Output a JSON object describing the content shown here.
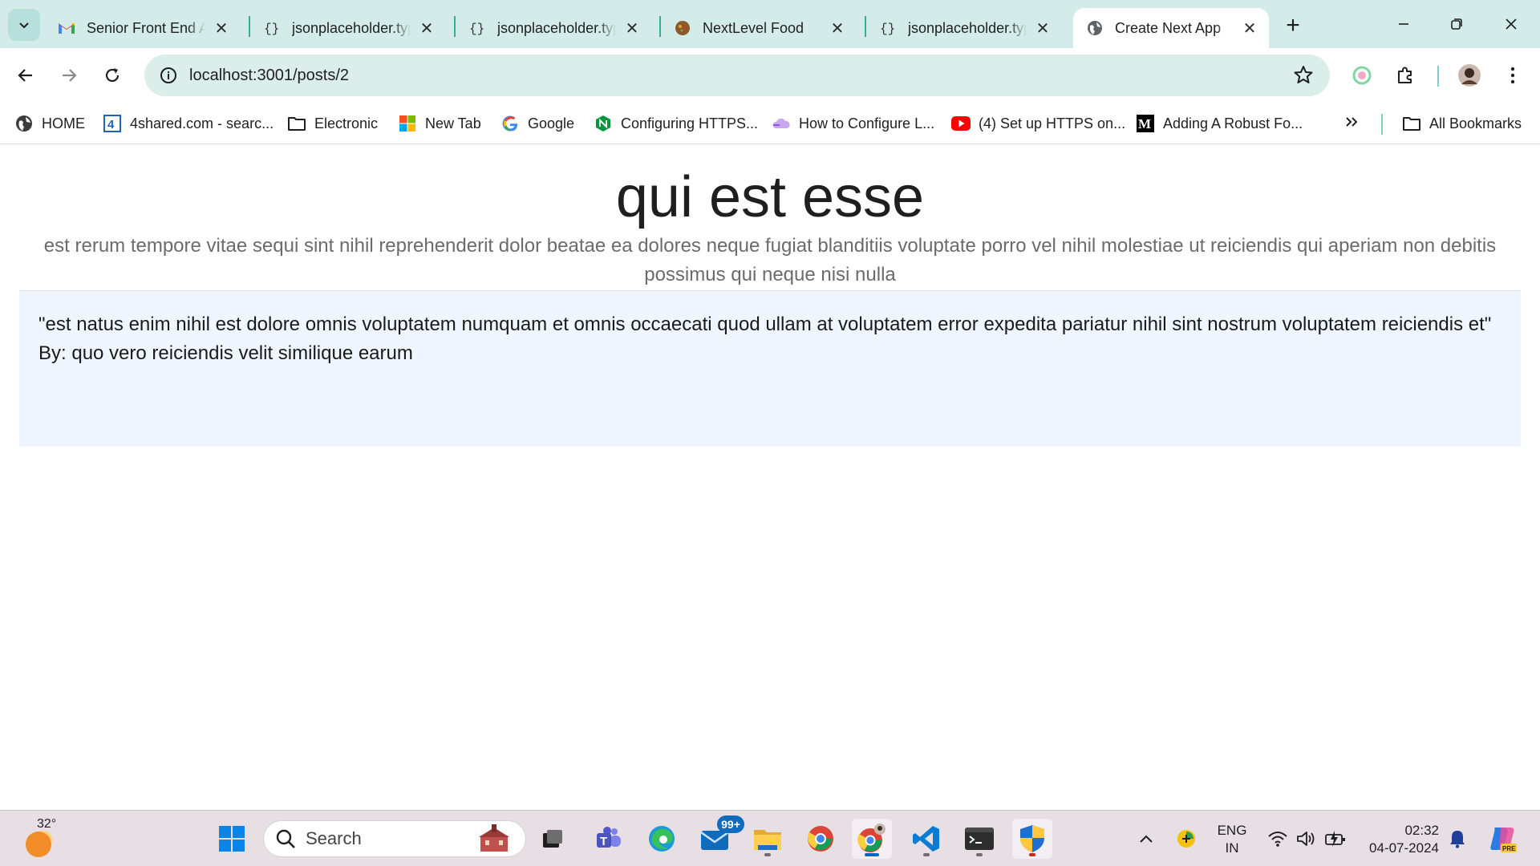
{
  "browser": {
    "tabs": [
      {
        "title": "Senior Front End A",
        "favicon": "gmail-icon",
        "active": false
      },
      {
        "title": "jsonplaceholder.typicode.com",
        "favicon": "jsonplaceholder-icon",
        "active": false
      },
      {
        "title": "jsonplaceholder.typicode.com",
        "favicon": "jsonplaceholder-icon",
        "active": false
      },
      {
        "title": "NextLevel Food",
        "favicon": "food-icon",
        "active": false
      },
      {
        "title": "jsonplaceholder.typicode.com",
        "favicon": "jsonplaceholder-icon",
        "active": false
      },
      {
        "title": "Create Next App",
        "favicon": "globe-icon",
        "active": true
      }
    ],
    "url": "localhost:3001/posts/2",
    "bookmarks": [
      {
        "label": "HOME",
        "icon": "globe-dark-icon"
      },
      {
        "label": "4shared.com - searc...",
        "icon": "4shared-icon"
      },
      {
        "label": "Electronic",
        "icon": "folder-icon"
      },
      {
        "label": "New Tab",
        "icon": "windows-logo-icon"
      },
      {
        "label": "Google",
        "icon": "google-icon"
      },
      {
        "label": "Configuring HTTPS...",
        "icon": "nginx-icon"
      },
      {
        "label": "How to Configure L...",
        "icon": "cloud-icon"
      },
      {
        "label": "(4) Set up HTTPS on...",
        "icon": "youtube-icon"
      },
      {
        "label": "Adding A Robust Fo...",
        "icon": "medium-icon"
      }
    ],
    "all_bookmarks_label": "All Bookmarks"
  },
  "post": {
    "title": "qui est esse",
    "body": "est rerum tempore vitae sequi sint nihil reprehenderit dolor beatae ea dolores neque fugiat blanditiis voluptate porro vel nihil molestiae ut reiciendis qui aperiam non debitis possimus qui neque nisi nulla",
    "comment": {
      "text": "\"est natus enim nihil est dolore omnis voluptatem numquam et omnis occaecati quod ullam at voluptatem error expedita pariatur nihil sint nostrum voluptatem reiciendis et\"",
      "author_line": "By: quo vero reiciendis velit similique earum"
    }
  },
  "taskbar": {
    "weather_temp": "32°",
    "search_placeholder": "Search",
    "mail_badge": "99+",
    "language_line1": "ENG",
    "language_line2": "IN",
    "time": "02:32",
    "date": "04-07-2024"
  },
  "colors": {
    "tabstrip_bg": "#d4ece9",
    "omnibox_bg": "#dbeee9",
    "comment_card_bg": "#eff6ff",
    "taskbar_bg": "#e7dfe4"
  }
}
